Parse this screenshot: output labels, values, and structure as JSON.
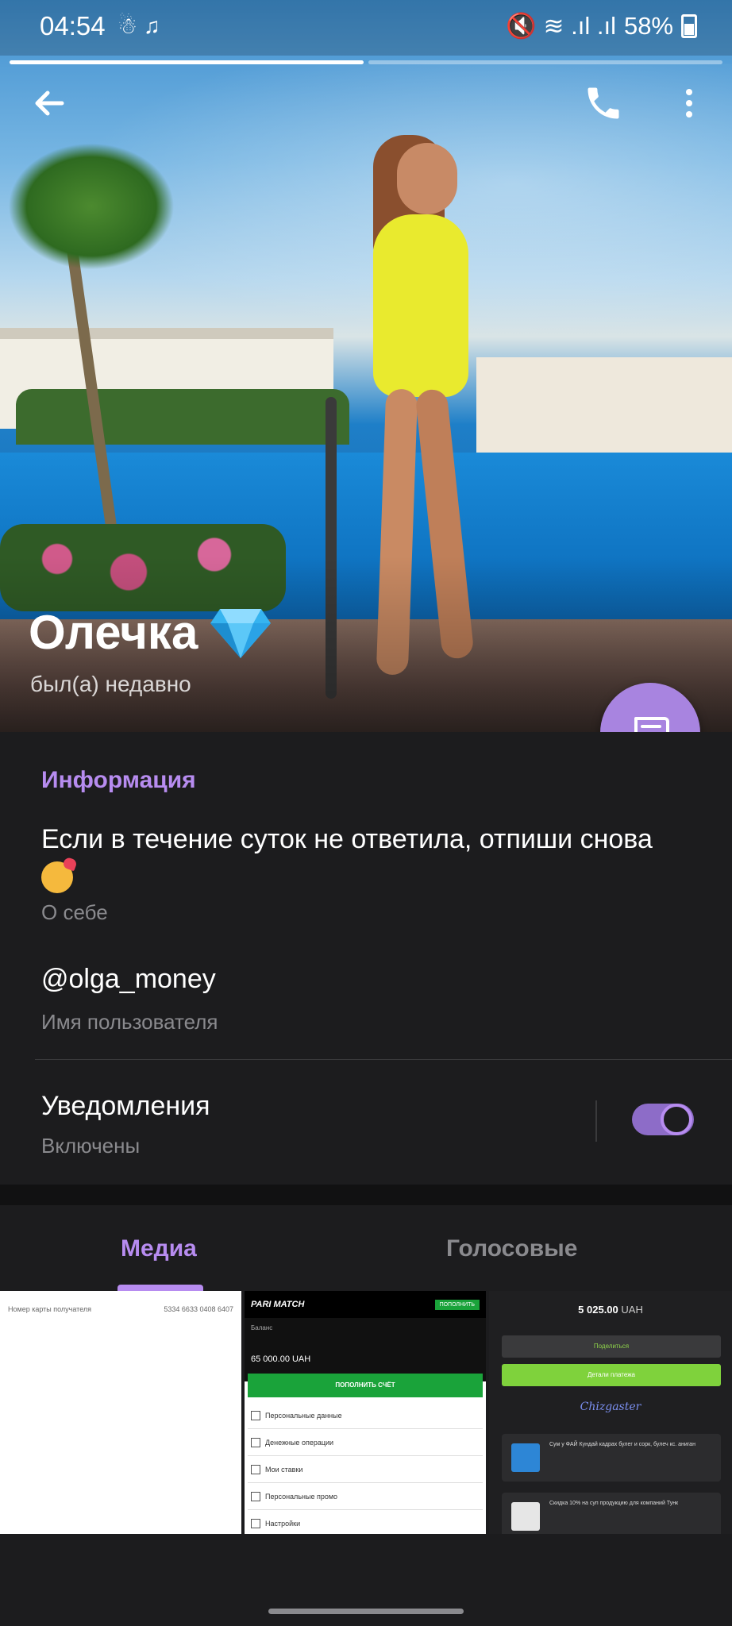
{
  "status_bar": {
    "time": "04:54",
    "left_icons": "☃ ♫",
    "right_icons": "🔇 ≋ .ıl .ıl",
    "battery": "58%"
  },
  "story_progress": [
    1,
    0
  ],
  "profile": {
    "name": "Олечка",
    "status": "был(а) недавно"
  },
  "info": {
    "section_title": "Информация",
    "bio": "Если в течение суток не ответила, отпиши снова",
    "bio_label": "О себе",
    "username": "@olga_money",
    "username_label": "Имя пользователя",
    "notifications_title": "Уведомления",
    "notifications_state": "Включены",
    "notifications_enabled": true
  },
  "tabs": [
    {
      "label": "Медиа",
      "active": true
    },
    {
      "label": "Голосовые",
      "active": false
    }
  ],
  "media": {
    "m1": {
      "left": "Номер карты получателя",
      "right": "5334 6633 0408 6407"
    },
    "m2": {
      "logo": "PARI MATCH",
      "top_button": "ПОПОЛНИТЬ",
      "balance_label": "Баланс",
      "balance_value": "65 000.00 UAH",
      "green_button": "ПОПОЛНИТЬ СЧЁТ",
      "menu": [
        "Персональные данные",
        "Денежные операции",
        "Мои ставки",
        "Персональные промо",
        "Настройки"
      ]
    },
    "m3": {
      "amount": "5 025.00",
      "currency": "UAH",
      "share": "Поделиться",
      "details": "Детали платежа",
      "brand": "Chizgaster",
      "card1": "Сум у ФАЙ Кундай кадрах булег и сорк, булеч кс. аниган",
      "card2": "Скидка 10% на суп продукцию для компаний Тунк"
    }
  },
  "colors": {
    "accent": "#b78cf0",
    "fab": "#a884e0",
    "background": "#1c1c1e"
  }
}
